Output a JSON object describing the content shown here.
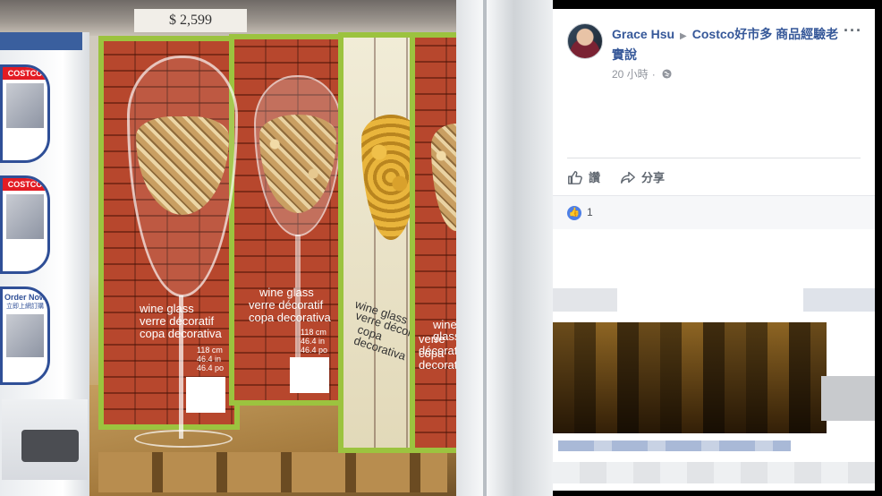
{
  "photo": {
    "price_tag": "$ 2,599",
    "stand": {
      "badge_logo": "COSTCO",
      "order_now": "Order Now",
      "order_now_sub": "立即上網訂購"
    },
    "boxes": [
      {
        "label_lines": [
          "wine glass",
          "verre décoratif",
          "copa decorativa"
        ],
        "size_lines": [
          "118 cm",
          "46.4 in",
          "46.4 po"
        ]
      },
      {
        "label_lines": [
          "wine glass",
          "verre décoratif",
          "copa decorativa"
        ],
        "size_lines": [
          "118 cm",
          "46.4 in",
          "46.4 po"
        ]
      },
      {
        "label_lines": [
          "wine glass",
          "verre décoratif",
          "copa decorativa"
        ],
        "size_lines": []
      },
      {
        "label_lines": [
          "wine glass",
          "verre décoratif",
          "copa decorativa"
        ],
        "size_lines": []
      }
    ]
  },
  "post": {
    "author": "Grace Hsu",
    "group": "Costco好市多 商品經驗老實說",
    "time": "20 小時",
    "privacy_icon": "globe-icon",
    "more_icon": "ellipsis-icon",
    "actions": {
      "like_label": "讚",
      "share_label": "分享"
    },
    "reactions": {
      "count": "1"
    }
  },
  "colors": {
    "facebook_link": "#365899",
    "box_trim": "#9cc33f",
    "brick": "#b7472d",
    "like_blue": "#4d7fe6"
  }
}
